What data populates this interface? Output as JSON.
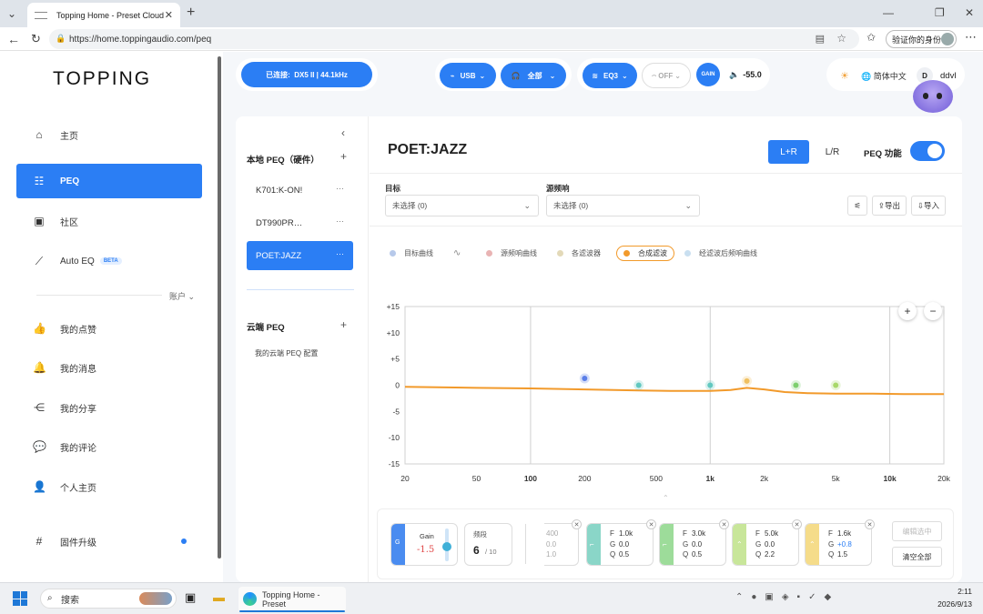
{
  "browser": {
    "tab_title": "Topping Home - Preset Cloud",
    "url": "https://home.toppingaudio.com/peq",
    "verify_label": "验证你的身份"
  },
  "sidebar": {
    "logo": "TOPPING",
    "items": [
      {
        "label": "主页",
        "icon": "home-icon"
      },
      {
        "label": "PEQ",
        "icon": "sliders-icon",
        "active": true
      },
      {
        "label": "社区",
        "icon": "community-icon"
      },
      {
        "label": "Auto EQ",
        "icon": "chart-icon",
        "badge": "BETA"
      }
    ],
    "account_label": "账户",
    "account_items": [
      {
        "label": "我的点赞",
        "icon": "thumbs-up-icon"
      },
      {
        "label": "我的消息",
        "icon": "bell-icon"
      },
      {
        "label": "我的分享",
        "icon": "share-icon"
      },
      {
        "label": "我的评论",
        "icon": "comment-icon"
      },
      {
        "label": "个人主页",
        "icon": "user-icon"
      },
      {
        "label": "固件升级",
        "icon": "hash-icon"
      }
    ]
  },
  "topbar": {
    "connected_label": "已连接:",
    "device": "DX5 II",
    "rate": "44.1kHz",
    "input": "USB",
    "output": "全部",
    "eq": "EQ3",
    "eq_off": "OFF",
    "gain_label": "GAIN",
    "volume": "-55.0",
    "language": "简体中文",
    "user_initial": "D",
    "username": "ddvl"
  },
  "peq_list": {
    "local_header": "本地 PEQ（硬件）",
    "local_items": [
      "K701:K-ON!",
      "DT990PR…",
      "POET:JAZZ"
    ],
    "cloud_header": "云端 PEQ",
    "cloud_item": "我的云端 PEQ 配置"
  },
  "editor": {
    "title": "POET:JAZZ",
    "channel_lr": "L+R",
    "channel_split": "L/R",
    "peq_label": "PEQ 功能",
    "target_label": "目标",
    "target_value": "未选择 (0)",
    "source_label": "源频响",
    "source_value": "未选择 (0)",
    "export_label": "导出",
    "import_label": "导入",
    "legend": [
      {
        "label": "目标曲线",
        "color": "#b7c9ea"
      },
      {
        "label": "",
        "color": "#888888"
      },
      {
        "label": "源频响曲线",
        "color": "#e9b4b4"
      },
      {
        "label": "各滤波器",
        "color": "#e3d9b8"
      },
      {
        "label": "合成滤波",
        "color": "#f29a2b"
      },
      {
        "label": "经滤波后频响曲线",
        "color": "#c9dff0"
      }
    ]
  },
  "chart_data": {
    "type": "line",
    "x_scale": "log",
    "xlim": [
      20,
      20000
    ],
    "ylim": [
      -15,
      15
    ],
    "x_ticks": [
      "20",
      "50",
      "100",
      "200",
      "500",
      "1k",
      "2k",
      "5k",
      "10k",
      "20k"
    ],
    "x_tick_values": [
      20,
      50,
      100,
      200,
      500,
      1000,
      2000,
      5000,
      10000,
      20000
    ],
    "y_ticks": [
      "+15",
      "+10",
      "+5",
      "0",
      "-5",
      "-10",
      "-15"
    ],
    "y_tick_values": [
      15,
      10,
      5,
      0,
      -5,
      -10,
      -15
    ],
    "series": [
      {
        "color": "#f29a2b",
        "x": [
          20,
          50,
          100,
          200,
          400,
          600,
          1000,
          1300,
          1600,
          2000,
          2600,
          3500,
          5000,
          8000,
          12000,
          20000
        ],
        "y": [
          -0.3,
          -0.5,
          -0.6,
          -0.8,
          -1.0,
          -1.1,
          -1.1,
          -0.9,
          -0.5,
          -0.8,
          -1.3,
          -1.5,
          -1.6,
          -1.6,
          -1.7,
          -1.7
        ]
      }
    ],
    "points": [
      {
        "x": 200,
        "y": 1.3,
        "color": "#5b7fe8"
      },
      {
        "x": 400,
        "y": 0.0,
        "color": "#62c8c0"
      },
      {
        "x": 1000,
        "y": 0.0,
        "color": "#62c8c0"
      },
      {
        "x": 1600,
        "y": 0.8,
        "color": "#f0c060"
      },
      {
        "x": 3000,
        "y": 0.0,
        "color": "#7dcf6e"
      },
      {
        "x": 5000,
        "y": 0.0,
        "color": "#a8d86a"
      }
    ]
  },
  "bands": {
    "gain_label": "Gain",
    "gain_value": "-1.5",
    "count_label": "频段",
    "count_value": "6",
    "count_total": "/ 10",
    "partial": [
      "400",
      "0.0",
      "1.0"
    ],
    "items": [
      {
        "F": "1.0k",
        "G": "0.0",
        "Q": "0.5",
        "color": "#8ad6c8"
      },
      {
        "F": "3.0k",
        "G": "0.0",
        "Q": "0.5",
        "color": "#9ddc9a"
      },
      {
        "F": "5.0k",
        "G": "0.0",
        "Q": "2.2",
        "color": "#c8e69a"
      },
      {
        "F": "1.6k",
        "G": "+0.8",
        "Q": "1.5",
        "color": "#f5dc8a"
      }
    ],
    "edit_selected": "编辑选中",
    "clear_all": "清空全部"
  },
  "taskbar": {
    "search": "搜索",
    "task_title": "Topping Home - Preset",
    "time": "2:11",
    "date": "2026/9/13"
  }
}
